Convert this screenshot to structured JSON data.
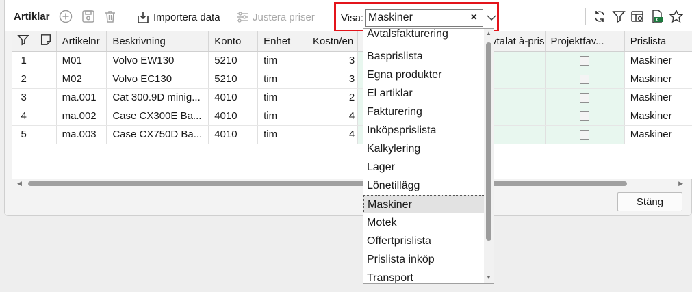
{
  "toolbar": {
    "title": "Artiklar",
    "import_label": "Importera data",
    "adjust_label": "Justera priser",
    "visa_label": "Visa:",
    "visa_value": "Maskiner",
    "clear_glyph": "×"
  },
  "grid": {
    "columns": [
      "Artikelnr",
      "Beskrivning",
      "Konto",
      "Enhet",
      "Kostn/en",
      "Avtalat à-pris",
      "Projektfav...",
      "Prislista"
    ],
    "rows": [
      {
        "num": "1",
        "artikelnr": "M01",
        "beskrivning": "Volvo EW130",
        "konto": "5210",
        "enhet": "tim",
        "kostn": "3",
        "prislista": "Maskiner"
      },
      {
        "num": "2",
        "artikelnr": "M02",
        "beskrivning": "Volvo EC130",
        "konto": "5210",
        "enhet": "tim",
        "kostn": "3",
        "prislista": "Maskiner"
      },
      {
        "num": "3",
        "artikelnr": "ma.001",
        "beskrivning": "Cat 300.9D minig...",
        "konto": "4010",
        "enhet": "tim",
        "kostn": "2",
        "prislista": "Maskiner"
      },
      {
        "num": "4",
        "artikelnr": "ma.002",
        "beskrivning": "Case CX300E Ba...",
        "konto": "4010",
        "enhet": "tim",
        "kostn": "4",
        "prislista": "Maskiner"
      },
      {
        "num": "5",
        "artikelnr": "ma.003",
        "beskrivning": "Case CX750D Ba...",
        "konto": "4010",
        "enhet": "tim",
        "kostn": "4",
        "prislista": "Maskiner"
      }
    ]
  },
  "dropdown": {
    "options": [
      "Avtalsfakturering",
      "Basprislista",
      "Egna produkter",
      "El artiklar",
      "Fakturering",
      "Inköpsprislista",
      "Kalkylering",
      "Lager",
      "Lönetillägg",
      "Maskiner",
      "Motek",
      "Offertprislista",
      "Prislista inköp",
      "Transport"
    ],
    "selected": "Maskiner"
  },
  "footer": {
    "close_label": "Stäng"
  },
  "colors": {
    "highlight_red": "#e3141b",
    "price_green": "#e8f7ef",
    "excel_green": "#1d7a3e"
  }
}
